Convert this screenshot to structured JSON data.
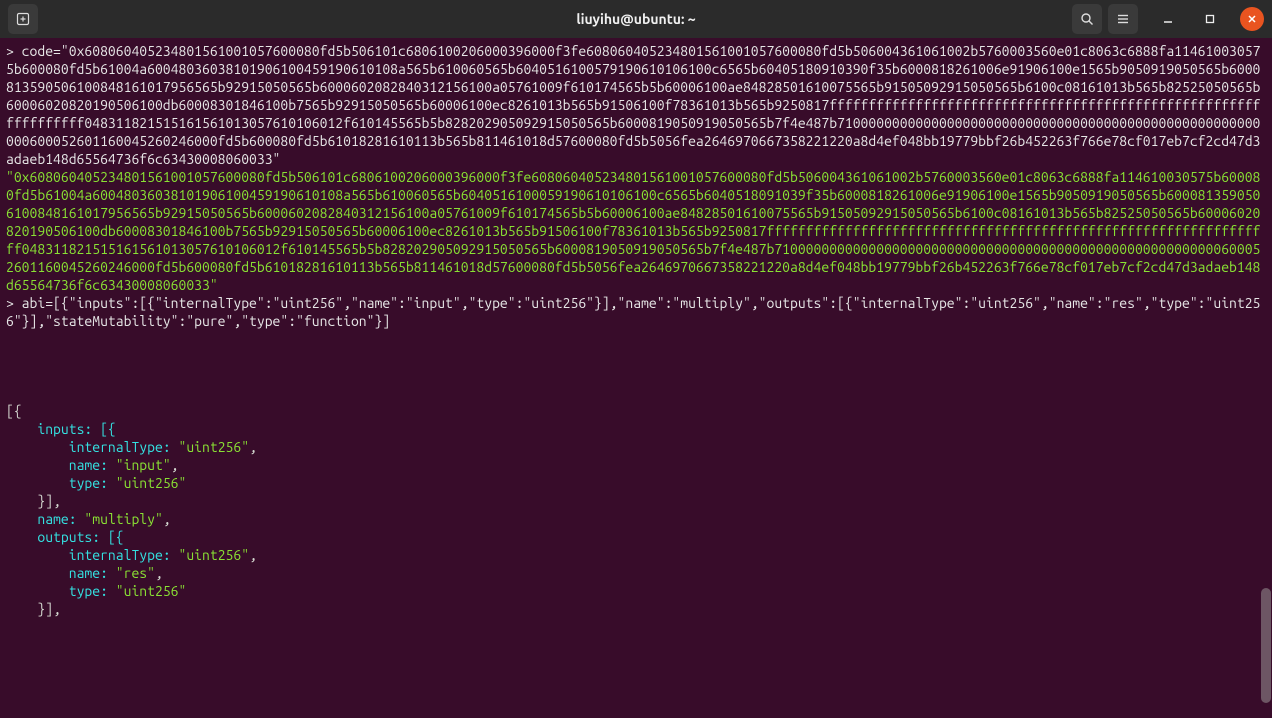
{
  "title": "liuyihu@ubuntu: ~",
  "code_cmd_prefix": "> code=",
  "code_hex": "\"0x608060405234801561001057600080fd5b506101c6806100206000396000f3fe608060405234801561001057600080fd5b506004361061002b5760003560e01c8063c6888fa114610030575b600080fd5b61004a60048036038101906100459190610108a565b610060565b6040516100579190610106100c6565b60405180910390f35b6000818261006e91906100e1565b9050919050565b6000813590506100848161017956565b92915050565b6000602082840312156100a05761009f610174565b5b60006100ae84828501610075565b91505092915050565b6100c08161013b565b82525050565b60006020820190506100db60008301846100b7565b92915050565b60006100ec8261013b565b91506100f78361013b565b9250817fffffffffffffffffffffffffffffffffffffffffffffffffffffffffffffffff048311821515161561013057610106012f610145565b5b828202905092915050565b6000819050919050565b7f4e487b710000000000000000000000000000000000000000000000000000000600052601160045260246000fd5b600080fd5b61018281610113b565b811461018d57600080fd5b5056fea2646970667358221220a8d4ef048bb19779bbf26b452263f766e78cf017eb7cf2cd47d3adaeb148d65564736f6c63430008060033\"",
  "code_echo": "\"0x608060405234801561001057600080fd5b506101c6806100206000396000f3fe608060405234801561001057600080fd5b506004361061002b5760003560e01c8063c6888fa114610030575b600080fd5b61004a60048036038101906100459190610108a565b610060565b6040516100059190610106100c6565b6040518091039f35b6000818261006e91906100e1565b9050919050565b6000813590506100848161017956565b92915050565b6000602082840312156100a05761009f610174565b5b60006100ae84828501610075565b91505092915050565b6100c08161013b565b82525050565b60006020820190506100db60008301846100b7565b92915050565b60006100ec8261013b565b91506100f78361013b565b9250817fffffffffffffffffffffffffffffffffffffffffffffffffffffffffffffffff048311821515161561013057610106012f610145565b5b828202905092915050565b6000819050919050565b7f4e487b710000000000000000000000000000000000000000000000000000000600052601160045260246000fd5b600080fd5b61018281610113b565b811461018d57600080fd5b5056fea2646970667358221220a8d4ef048bb19779bbf26b452263f766e78cf017eb7cf2cd47d3adaeb148d65564736f6c63430008060033\"",
  "abi_cmd_prefix": "> abi=",
  "abi_cmd_body": "[{\"inputs\":[{\"internalType\":\"uint256\",\"name\":\"input\",\"type\":\"uint256\"}],\"name\":\"multiply\",\"outputs\":[{\"internalType\":\"uint256\",\"name\":\"res\",\"type\":\"uint256\"}],\"stateMutability\":\"pure\",\"type\":\"function\"}]",
  "abi_out": {
    "open": "[{",
    "inputs_open": "    inputs: [{",
    "inputs_internalType_k": "        internalType: ",
    "inputs_internalType_v": "\"uint256\"",
    "inputs_name_k": "        name: ",
    "inputs_name_v": "\"input\"",
    "inputs_type_k": "        type: ",
    "inputs_type_v": "\"uint256\"",
    "inputs_close": "    }],",
    "name_k": "    name: ",
    "name_v": "\"multiply\"",
    "outputs_open": "    outputs: [{",
    "outputs_internalType_k": "        internalType: ",
    "outputs_internalType_v": "\"uint256\"",
    "outputs_name_k": "        name: ",
    "outputs_name_v": "\"res\"",
    "outputs_type_k": "        type: ",
    "outputs_type_v": "\"uint256\"",
    "outputs_close": "    }],"
  }
}
